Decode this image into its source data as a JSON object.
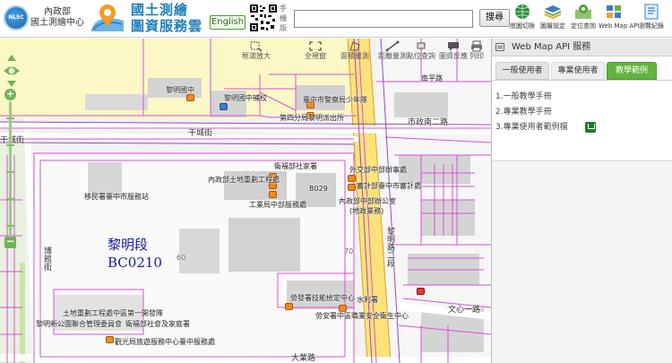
{
  "header": {
    "org_line1": "內政部",
    "org_line2": "國土測繪中心",
    "brand_line1": "國土測繪",
    "brand_line2": "圖資服務雲",
    "language_button": "English",
    "phone_label": "手機版",
    "search_placeholder": "",
    "search_button": "搜尋",
    "tools": [
      {
        "label": "底圖切換",
        "icon": "globe-icon",
        "color": "#2e8b3e"
      },
      {
        "label": "圖層設定",
        "icon": "layers-icon",
        "color": "#3a7fc0"
      },
      {
        "label": "定位查詢",
        "icon": "locate-icon",
        "color": "#5aa03a"
      },
      {
        "label": "Web Map API",
        "icon": "api-icon",
        "color": "#3a7fc0"
      },
      {
        "label": "瀏覽紀錄",
        "icon": "history-icon",
        "color": "#3a7fc0"
      }
    ]
  },
  "map_toolbar": [
    {
      "label": "框選放大",
      "icon": "zoom-box-icon"
    },
    {
      "label": "全視窗",
      "icon": "fullscreen-icon"
    },
    {
      "label": "面積量測",
      "icon": "area-measure-icon"
    },
    {
      "label": "距離量測",
      "icon": "distance-measure-icon"
    },
    {
      "label": "點位查詢",
      "icon": "point-query-icon"
    },
    {
      "label": "圖資反應",
      "icon": "feedback-icon"
    },
    {
      "label": "列印",
      "icon": "print-icon"
    }
  ],
  "map": {
    "parcel_label_line1": "黎明段",
    "parcel_label_line2": "BC0210",
    "labels": {
      "school_1": "黎明國中",
      "school_2": "黎明國中補校",
      "police_1": "臺中市警察局少年隊",
      "police_2": "第四分局黎明派出所",
      "road_1": "干城街",
      "road_2": "干城街",
      "road_3": "市政南二路",
      "road_4": "黎明路二段",
      "road_5": "文心一路",
      "road_6": "大業路",
      "road_7": "博館街",
      "road_8": "大業",
      "social_1": "衛福部社家署",
      "affairs_1": "外交部中部辦事處",
      "audit_1": "審計部臺中市審計處",
      "land_1": "內政部土地重劃工程處",
      "b029": "B029",
      "finance_1": "財政部中區國稅局",
      "immigration_1": "移民署臺中市服務站",
      "ministry_1": "內政部中部辦公室",
      "ministry_2": "(地政業務)",
      "industry_1": "工業局中部服務處",
      "elev_60": "60",
      "elev_70": "70",
      "labor_1": "勞動部職能發展署",
      "labor_2": "勞發署技能檢定中心",
      "water_1": "水利署",
      "land_2": "土地重劃工程處中區第一開發隊",
      "community_1": "黎明新公園聯合管理委員會",
      "social_2": "衛福部社會及家庭署",
      "tourism_1": "觀光局旅遊服務中心臺中服務處",
      "insurance_1": "勞安署中區職業安全衛生中心",
      "road_top": "南平路"
    }
  },
  "panel": {
    "title": "Web Map API 服務",
    "tabs": [
      "一般使用者",
      "專業使用者",
      "教學範例"
    ],
    "docs": [
      "1.一般教學手冊",
      "2.專業教學手冊",
      "3.專業使用者範例檔"
    ]
  }
}
